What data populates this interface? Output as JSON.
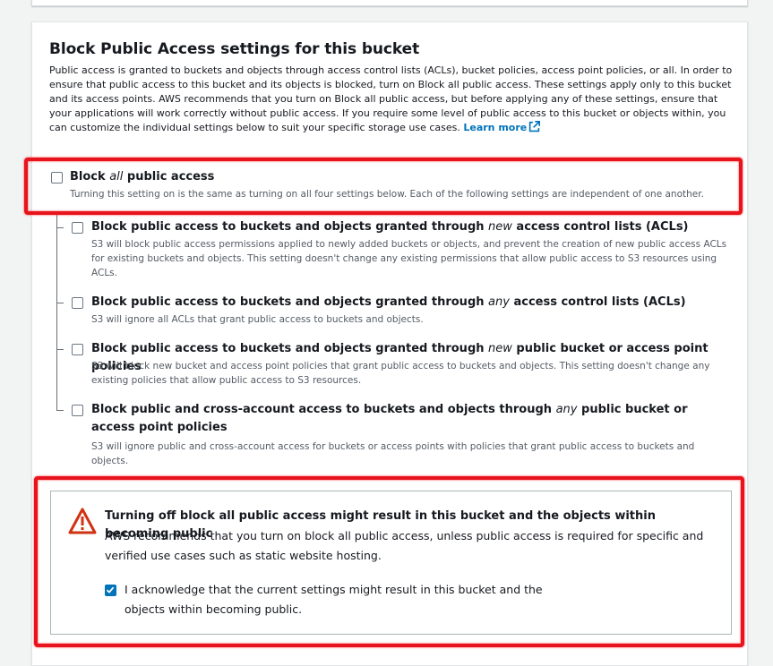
{
  "section": {
    "title": "Block Public Access settings for this bucket",
    "intro": "Public access is granted to buckets and objects through access control lists (ACLs), bucket policies, access point policies, or all. In order to ensure that public access to this bucket and its objects is blocked, turn on Block all public access. These settings apply only to this bucket and its access points. AWS recommends that you turn on Block all public access, but before applying any of these settings, ensure that your applications will work correctly without public access. If you require some level of public access to this bucket or objects within, you can customize the individual settings below to suit your specific storage use cases.",
    "learn_more": "Learn more"
  },
  "block_all": {
    "label_pre": "Block ",
    "label_em": "all",
    "label_post": " public access",
    "description": "Turning this setting on is the same as turning on all four settings below. Each of the following settings are independent of one another.",
    "checked": false
  },
  "options": [
    {
      "label_pre": "Block public access to buckets and objects granted through ",
      "label_em": "new",
      "label_post": " access control lists (ACLs)",
      "description": "S3 will block public access permissions applied to newly added buckets or objects, and prevent the creation of new public access ACLs for existing buckets and objects. This setting doesn't change any existing permissions that allow public access to S3 resources using ACLs.",
      "checked": false
    },
    {
      "label_pre": "Block public access to buckets and objects granted through ",
      "label_em": "any",
      "label_post": " access control lists (ACLs)",
      "description": "S3 will ignore all ACLs that grant public access to buckets and objects.",
      "checked": false
    },
    {
      "label_pre": "Block public access to buckets and objects granted through ",
      "label_em": "new",
      "label_post": " public bucket or access point policies",
      "description": "S3 will block new bucket and access point policies that grant public access to buckets and objects. This setting doesn't change any existing policies that allow public access to S3 resources.",
      "checked": false
    },
    {
      "label_pre": "Block public and cross-account access to buckets and objects through ",
      "label_em": "any",
      "label_post": " public bucket or access point policies",
      "description": "S3 will ignore public and cross-account access for buckets or access points with policies that grant public access to buckets and objects.",
      "checked": false
    }
  ],
  "warning": {
    "title": "Turning off block all public access might result in this bucket and the objects within becoming public",
    "body": "AWS recommends that you turn on block all public access, unless public access is required for specific and verified use cases such as static website hosting.",
    "acknowledge_label": "I acknowledge that the current settings might result in this bucket and the objects within becoming public.",
    "acknowledged": true
  },
  "colors": {
    "link": "#0073bb",
    "checkbox_checked": "#0073bb",
    "warning_icon": "#d13212",
    "highlight_annotation": "#e8141d"
  }
}
